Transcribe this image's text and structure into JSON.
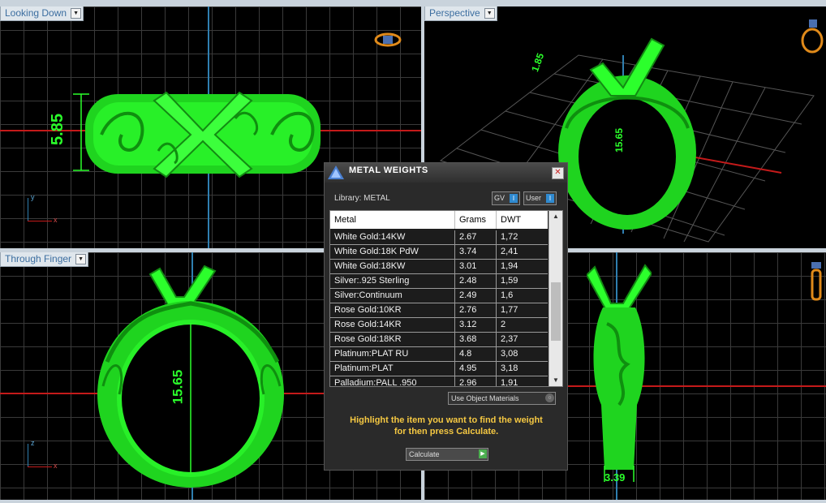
{
  "viewports": {
    "top_left": {
      "label": "Looking Down",
      "dimension": "5.85",
      "axis_x": "x",
      "axis_y": "y"
    },
    "top_right": {
      "label": "Perspective",
      "dimension_a": "1.85",
      "dimension_b": "15.65"
    },
    "bottom_left": {
      "label": "Through Finger",
      "dimension": "15.65",
      "axis_x": "x",
      "axis_y": "z"
    },
    "bottom_right": {
      "dimension": "3.39"
    }
  },
  "dialog": {
    "title": "METAL WEIGHTS",
    "close": "✕",
    "library_label": "Library: METAL",
    "toggle_gv": "GV",
    "toggle_user": "User",
    "columns": [
      "Metal",
      "Grams",
      "DWT"
    ],
    "rows": [
      [
        "White Gold:14KW",
        "2.67",
        "1,72"
      ],
      [
        "White Gold:18K PdW",
        "3.74",
        "2,41"
      ],
      [
        "White Gold:18KW",
        "3.01",
        "1,94"
      ],
      [
        "Silver:.925 Sterling",
        "2.48",
        "1,59"
      ],
      [
        "Silver:Continuum",
        "2.49",
        "1,6"
      ],
      [
        "Rose Gold:10KR",
        "2.76",
        "1,77"
      ],
      [
        "Rose Gold:14KR",
        "3.12",
        "2"
      ],
      [
        "Rose Gold:18KR",
        "3.68",
        "2,37"
      ],
      [
        "Platinum:PLAT RU",
        "4.8",
        "3,08"
      ],
      [
        "Platinum:PLAT",
        "4.95",
        "3,18"
      ],
      [
        "Palladium:PALL .950",
        "2.96",
        "1,91"
      ]
    ],
    "use_object_materials": "Use Object Materials",
    "hint_line1": "Highlight the item you want to find the weight",
    "hint_line2": "for then press Calculate.",
    "calculate": "Calculate"
  },
  "colors": {
    "model": "#22ee22",
    "grid": "#3a3a3a",
    "x_axis": "#c41a1a",
    "y_axis": "#2f7fb0",
    "hint": "#f5c842"
  }
}
